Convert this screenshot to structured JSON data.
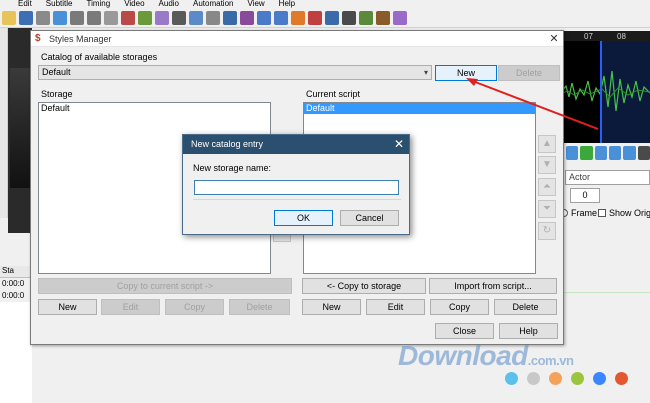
{
  "app": {
    "menu": [
      "Edit",
      "Subtitle",
      "Timing",
      "Video",
      "Audio",
      "Automation",
      "View",
      "Help"
    ],
    "audio_ticks": [
      "07",
      "08"
    ],
    "actor_placeholder": "Actor",
    "layer_value": "0",
    "frame_label": "Frame",
    "show_original_label": "Show Origi",
    "grid_header": "Sta",
    "grid_rows": [
      "0:00:0",
      "0:00:0"
    ]
  },
  "styles_manager": {
    "title": "Styles Manager",
    "catalog_label": "Catalog of available storages",
    "catalog_value": "Default",
    "new_catalog_btn": "New",
    "delete_catalog_btn": "Delete",
    "storage_label": "Storage",
    "storage_items": [
      "Default"
    ],
    "current_script_label": "Current script",
    "script_items": [
      "Default"
    ],
    "copy_to_script_btn": "Copy to current script ->",
    "storage_new_btn": "New",
    "storage_edit_btn": "Edit",
    "storage_copy_btn": "Copy",
    "storage_delete_btn": "Delete",
    "copy_to_storage_btn": "<- Copy to storage",
    "import_btn": "Import from script...",
    "script_new_btn": "New",
    "script_edit_btn": "Edit",
    "script_copy_btn": "Copy",
    "script_delete_btn": "Delete",
    "close_btn": "Close",
    "help_btn": "Help"
  },
  "new_entry_dialog": {
    "title": "New catalog entry",
    "prompt": "New storage name:",
    "input_value": "",
    "ok_btn": "OK",
    "cancel_btn": "Cancel"
  },
  "watermark": {
    "text": "Download",
    "tld": ".com.vn",
    "dot_colors": [
      "#5bc0eb",
      "#c8c8c8",
      "#f4a259",
      "#9bc53d",
      "#3a86ff",
      "#e4572e"
    ]
  },
  "colors": {
    "dialog_title_bar": "#2b4f6f",
    "selection": "#3399ff",
    "annotation_arrow": "#e02020"
  }
}
